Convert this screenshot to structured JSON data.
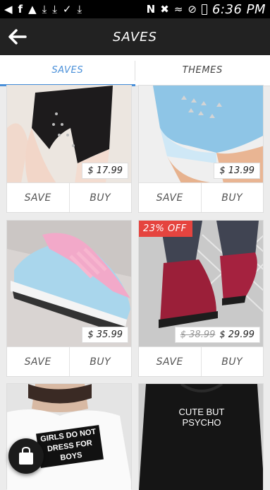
{
  "status_bar": {
    "time": "6:36 PM"
  },
  "app_bar": {
    "title": "SAVES"
  },
  "tabs": [
    {
      "label": "SAVES",
      "active": true
    },
    {
      "label": "THEMES",
      "active": false
    }
  ],
  "colors": {
    "accent": "#4a90d9",
    "app_bar": "#222222",
    "sale_badge": "#e5443f"
  },
  "products": [
    {
      "price": "$ 17.99",
      "save_label": "SAVE",
      "buy_label": "BUY"
    },
    {
      "price": "$ 13.99",
      "save_label": "SAVE",
      "buy_label": "BUY"
    },
    {
      "price": "$ 35.99",
      "save_label": "SAVE",
      "buy_label": "BUY"
    },
    {
      "badge": "23% OFF",
      "old_price": "$ 38.99",
      "price": "$ 29.99",
      "save_label": "SAVE",
      "buy_label": "BUY"
    },
    {
      "shirt_text": "GIRLS DO NOT DRESS FOR BOYS"
    },
    {
      "shirt_text": "CUTE BUT PSYCHO"
    }
  ],
  "fab": {
    "icon": "shopping-bag-icon"
  }
}
